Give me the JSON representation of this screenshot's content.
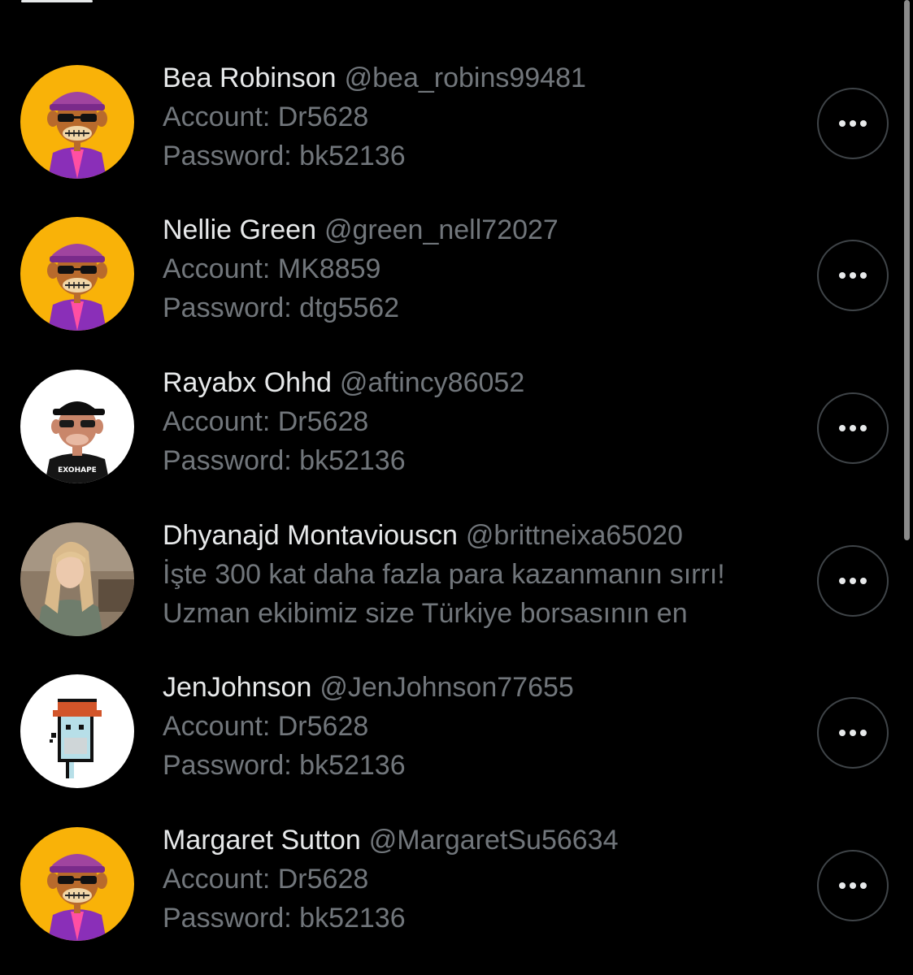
{
  "replies": [
    {
      "name": "Bea Robinson",
      "handle": "@bea_robins99481",
      "line1": "Account: Dr5628",
      "line2": "Password: bk52136",
      "avatar": "bored-ape-yellow"
    },
    {
      "name": "Nellie Green",
      "handle": "@green_nell72027",
      "line1": "Account: MK8859",
      "line2": "Password: dtg5562",
      "avatar": "bored-ape-yellow"
    },
    {
      "name": "Rayabx Ohhd",
      "handle": "@aftincy86052",
      "line1": "Account: Dr5628",
      "line2": "Password: bk52136",
      "avatar": "ape-black-cap",
      "avatar_text": "EXOHAPE"
    },
    {
      "name": "Dhyanajd Montaviouscn",
      "handle": "@brittneixa65020",
      "line1": "İşte 300 kat daha fazla para kazanmanın sırrı!",
      "line2": "Uzman ekibimiz size Türkiye borsasının en",
      "avatar": "woman-photo"
    },
    {
      "name": "JenJohnson",
      "handle": "@JenJohnson77655",
      "line1": "Account: Dr5628",
      "line2": "Password: bk52136",
      "avatar": "pixel-punk"
    },
    {
      "name": "Margaret Sutton",
      "handle": "@MargaretSu56634",
      "line1": "Account: Dr5628",
      "line2": "Password: bk52136",
      "avatar": "bored-ape-yellow"
    }
  ],
  "icons": {
    "more": "more-horizontal-icon"
  },
  "colors": {
    "background": "#000000",
    "primary_text": "#e7e9ea",
    "secondary_text": "#71767b",
    "button_border": "#3f4448",
    "ape_background": "#f9b208"
  }
}
